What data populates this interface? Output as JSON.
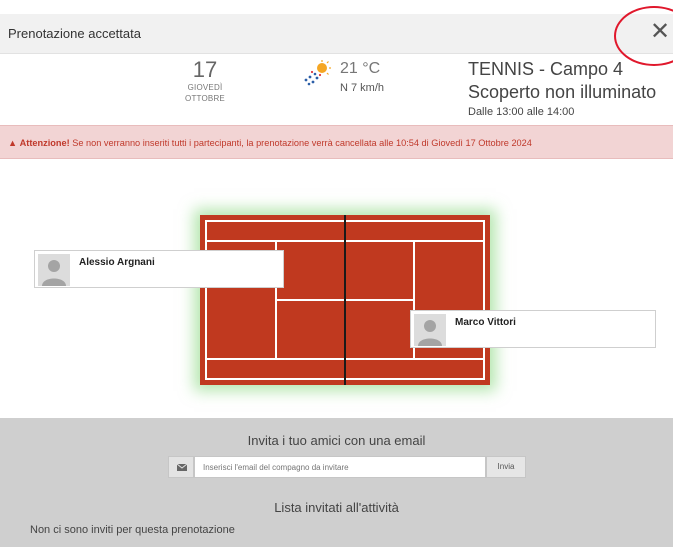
{
  "header": {
    "title": "Prenotazione accettata",
    "close_label": "✕"
  },
  "date": {
    "day": "17",
    "weekday": "GIOVEDÌ",
    "month": "OTTOBRE"
  },
  "weather": {
    "temperature": "21 °C",
    "wind": "N 7 km/h",
    "icon": "partly-sunny-rain-icon"
  },
  "court": {
    "name": "TENNIS - Campo 4",
    "type": "Scoperto non illuminato",
    "time": "Dalle 13:00 alle 14:00"
  },
  "alert": {
    "strong": "Attenzione!",
    "message": " Se non verranno inseriti tutti i partecipanti, la prenotazione verrà cancellata alle 10:54 di Giovedì 17 Ottobre 2024"
  },
  "players": [
    {
      "name": "Alessio Argnani"
    },
    {
      "name": "Marco Vittori"
    }
  ],
  "invite": {
    "title": "Invita i tuo amici con una email",
    "placeholder": "Inserisci l'email del compagno da invitare",
    "send_label": "Invia"
  },
  "invited_list": {
    "title": "Lista invitati all'attività",
    "empty_message": "Non ci sono inviti per questa prenotazione"
  },
  "colors": {
    "court": "#c0391f",
    "alert_bg": "#f2d4d4",
    "alert_text": "#c0392b",
    "annotation": "#e0182c"
  }
}
